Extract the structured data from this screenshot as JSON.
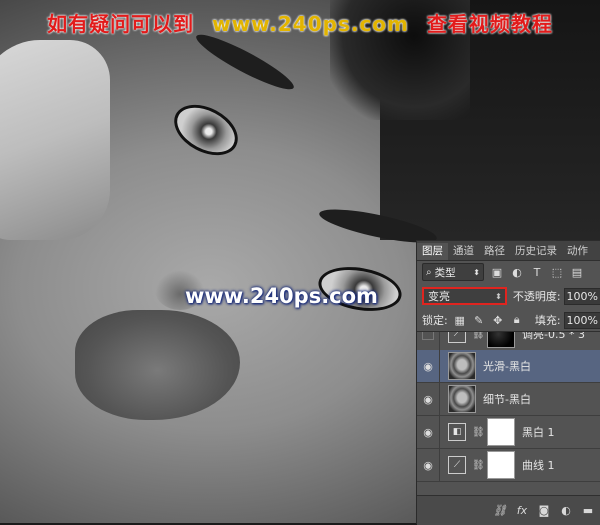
{
  "banner": {
    "prefix": "如有疑问可以到",
    "url": "www.240ps.com",
    "suffix": "查看视频教程"
  },
  "watermark": "www.240ps.com",
  "panel": {
    "tabs": [
      "图层",
      "通道",
      "路径",
      "历史记录",
      "动作"
    ],
    "filter_kind": "类型",
    "blend_mode": "变亮",
    "opacity_label": "不透明度:",
    "opacity_value": "100%",
    "lock_label": "锁定:",
    "fill_label": "填充:",
    "fill_value": "100%",
    "layers": [
      {
        "name": "调亮-0.5 * 3",
        "visible": false,
        "type": "adjustment"
      },
      {
        "name": "光滑-黑白",
        "visible": true,
        "type": "image",
        "selected": true
      },
      {
        "name": "细节-黑白",
        "visible": true,
        "type": "image"
      },
      {
        "name": "黑白 1",
        "visible": true,
        "type": "adjustment"
      },
      {
        "name": "曲线 1",
        "visible": true,
        "type": "adjustment"
      }
    ],
    "footer_icons": [
      "link-icon",
      "fx-icon",
      "mask-icon",
      "adjustment-icon",
      "folder-icon"
    ]
  }
}
